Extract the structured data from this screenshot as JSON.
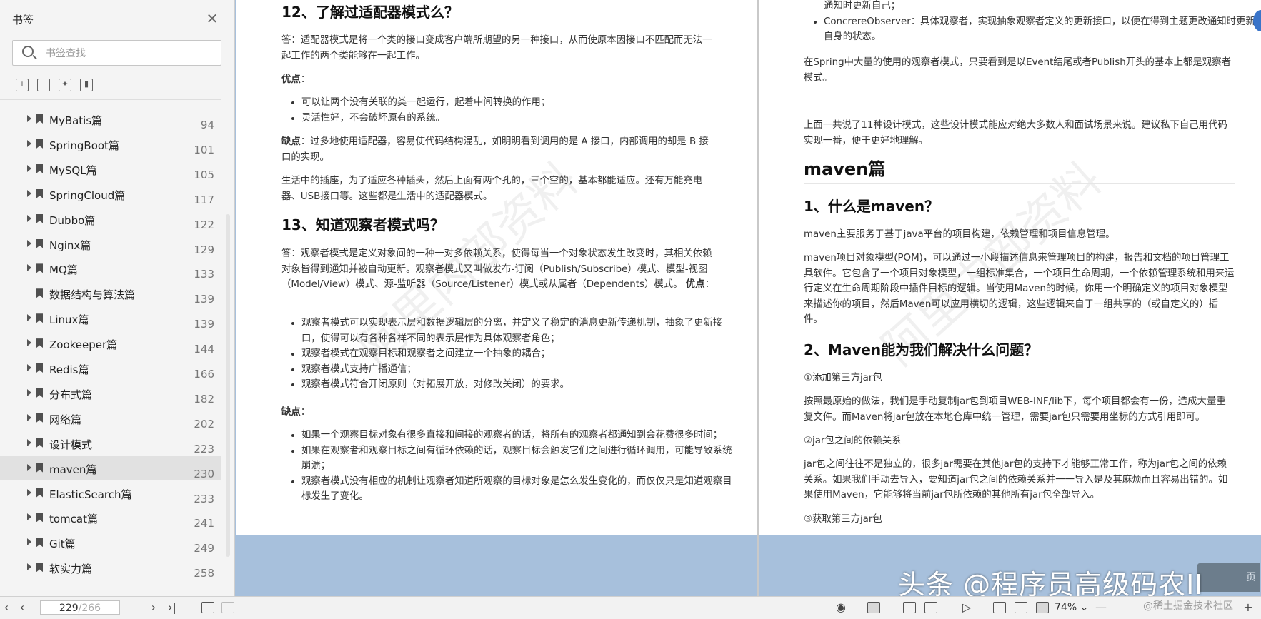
{
  "sidebar": {
    "title": "书签",
    "close_icon": "close-icon",
    "search_placeholder": "书签查找",
    "tools": [
      "expand-all-icon",
      "collapse-all-icon",
      "add-bookmark-icon",
      "bookmark-icon"
    ],
    "items": [
      {
        "name": "MyBatis篇",
        "page": "94",
        "expandable": true
      },
      {
        "name": "SpringBoot篇",
        "page": "101",
        "expandable": true
      },
      {
        "name": "MySQL篇",
        "page": "105",
        "expandable": true
      },
      {
        "name": "SpringCloud篇",
        "page": "117",
        "expandable": true
      },
      {
        "name": "Dubbo篇",
        "page": "122",
        "expandable": true
      },
      {
        "name": "Nginx篇",
        "page": "129",
        "expandable": true
      },
      {
        "name": "MQ篇",
        "page": "133",
        "expandable": true
      },
      {
        "name": "数据结构与算法篇",
        "page": "139",
        "expandable": false
      },
      {
        "name": "Linux篇",
        "page": "139",
        "expandable": true
      },
      {
        "name": "Zookeeper篇",
        "page": "144",
        "expandable": true
      },
      {
        "name": "Redis篇",
        "page": "166",
        "expandable": true
      },
      {
        "name": "分布式篇",
        "page": "182",
        "expandable": true
      },
      {
        "name": "网络篇",
        "page": "202",
        "expandable": true
      },
      {
        "name": "设计模式",
        "page": "223",
        "expandable": true
      },
      {
        "name": "maven篇",
        "page": "230",
        "expandable": true,
        "active": true
      },
      {
        "name": "ElasticSearch篇",
        "page": "233",
        "expandable": true
      },
      {
        "name": "tomcat篇",
        "page": "241",
        "expandable": true
      },
      {
        "name": "Git篇",
        "page": "249",
        "expandable": true
      },
      {
        "name": "软实力篇",
        "page": "258",
        "expandable": true
      }
    ]
  },
  "left_page": {
    "watermark": "阿里内部资料",
    "h12": "12、了解过适配器模式么？",
    "p_answer": "答：适配器模式是将一个类的接口变成客户端所期望的另一种接口，从而使原本因接口不匹配而无法一起工作的两个类能够在一起工作。",
    "pros_label": "优点",
    "pros_colon": "：",
    "pros": [
      "可以让两个没有关联的类一起运行，起着中间转换的作用；",
      "灵活性好，不会破坏原有的系统。"
    ],
    "cons_label": "缺点",
    "cons_text": "：过多地使用适配器，容易使代码结构混乱，如明明看到调用的是 A 接口，内部调用的却是 B 接口的实现。",
    "p_life": "生活中的插座，为了适应各种插头，然后上面有两个孔的，三个空的，基本都能适应。还有万能充电器、USB接口等。这些都是生活中的适配器模式。",
    "h13": "13、知道观察者模式吗？",
    "p_obs": "答：观察者模式是定义对象间的一种一对多依赖关系，使得每当一个对象状态发生改变时，其相关依赖对象皆得到通知并被自动更新。观察者模式又叫做发布-订阅（Publish/Subscribe）模式、模型-视图（Model/View）模式、源-监听器（Source/Listener）模式或从属者（Dependents）模式。",
    "obs_pros_label": "优点",
    "obs_pros_colon": "：",
    "obs_pros": [
      "观察者模式可以实现表示层和数据逻辑层的分离，并定义了稳定的消息更新传递机制，抽象了更新接口，使得可以有各种各样不同的表示层作为具体观察者角色；",
      "观察者模式在观察目标和观察者之间建立一个抽象的耦合；",
      "观察者模式支持广播通信；",
      "观察者模式符合开闭原则（对拓展开放，对修改关闭）的要求。"
    ],
    "obs_cons_label": "缺点",
    "obs_cons_colon": "：",
    "obs_cons": [
      "如果一个观察目标对象有很多直接和间接的观察者的话，将所有的观察者都通知到会花费很多时间；",
      "如果在观察者和观察目标之间有循环依赖的话，观察目标会触发它们之间进行循环调用，可能导致系统崩溃；",
      "观察者模式没有相应的机制让观察者知道所观察的目标对象是怎么发生变化的，而仅仅只是知道观察目标发生了变化。"
    ]
  },
  "right_page": {
    "watermark": "阿里内部资料",
    "top_bullets": [
      "通知时更新自己；",
      "ConcrereObserver：具体观察者，实现抽象观察者定义的更新接口，以便在得到主题更改通知时更新自身的状态。"
    ],
    "p_spring": "在Spring中大量的使用的观察者模式，只要看到是以Event结尾或者Publish开头的基本上都是观察者模式。",
    "p_summary": "上面一共说了11种设计模式，这些设计模式能应对绝大多数人和面试场景来说。建议私下自己用代码实现一番，便于更好地理解。",
    "h_maven": "maven篇",
    "h_q1": "1、什么是maven？",
    "p_maven1": "maven主要服务于基于java平台的项目构建，依赖管理和项目信息管理。",
    "p_maven2": "maven项目对象模型(POM)，可以通过一小段描述信息来管理项目的构建，报告和文档的项目管理工具软件。它包含了一个项目对象模型，一组标准集合，一个项目生命周期，一个依赖管理系统和用来运行定义在生命周期阶段中插件目标的逻辑。当使用Maven的时候，你用一个明确定义的项目对象模型来描述你的项目，然后Maven可以应用横切的逻辑，这些逻辑来自于一组共享的（或自定义的）插件。",
    "h_q2": "2、Maven能为我们解决什么问题？",
    "p_add": "①添加第三方jar包",
    "p_add_desc": "按照最原始的做法，我们是手动复制jar包到项目WEB-INF/lib下，每个项目都会有一份，造成大量重复文件。而Maven将jar包放在本地仓库中统一管理，需要jar包只需要用坐标的方式引用即可。",
    "p_dep": "②jar包之间的依赖关系",
    "p_dep_desc": "jar包之间往往不是独立的，很多jar需要在其他jar包的支持下才能够正常工作，称为jar包之间的依赖关系。如果我们手动去导入，要知道jar包之间的依赖关系并一一导入是及其麻烦而且容易出错的。如果使用Maven，它能够将当前jar包所依赖的其他所有jar包全部导入。",
    "p_get": "③获取第三方jar包"
  },
  "statusbar": {
    "current_page": "229",
    "total_pages": "/266",
    "zoom": "74%",
    "zoom_dropdown": "⌄",
    "zoom_minus": "—",
    "zoom_plus": "+"
  },
  "overlay": {
    "brand": "头条 @程序员高级码农II",
    "brand_small": "@稀土掘金技术社区",
    "side_tab": "页"
  }
}
